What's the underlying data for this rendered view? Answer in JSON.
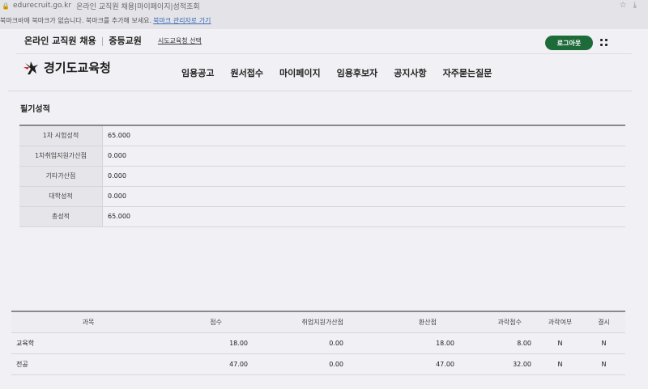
{
  "browser": {
    "url": "edurecruit.go.kr",
    "page_title": "온라인 교직원 채용|마이페이지|성적조회",
    "bookmark_message": "북마크바에 북마크가 없습니다. 북마크를 추가해 보세요.",
    "bookmark_link": "북마크 관리자로 가기"
  },
  "header": {
    "service_name": "온라인 교직원 채용",
    "category": "중등교원",
    "region_select": "시도교육청 선택",
    "logout_label": "로그아웃",
    "brand_name": "경기도교육청"
  },
  "nav": {
    "items": [
      "임용공고",
      "원서접수",
      "마이페이지",
      "임용후보자",
      "공지사항",
      "자주묻는질문"
    ]
  },
  "written_score": {
    "title": "필기성적",
    "rows": [
      {
        "label": "1차 시험성적",
        "value": "65.000"
      },
      {
        "label": "1차취업지원가산점",
        "value": "0.000"
      },
      {
        "label": "기타가산점",
        "value": "0.000"
      },
      {
        "label": "대학성적",
        "value": "0.000"
      },
      {
        "label": "총성적",
        "value": "65.000"
      }
    ]
  },
  "subject_table": {
    "headers": [
      "과목",
      "점수",
      "취업지원가산점",
      "환산점",
      "과락점수",
      "과락여부",
      "결시"
    ],
    "rows": [
      [
        "교육학",
        "18.00",
        "0.00",
        "18.00",
        "8.00",
        "N",
        "N"
      ],
      [
        "전공",
        "47.00",
        "0.00",
        "47.00",
        "32.00",
        "N",
        "N"
      ]
    ]
  },
  "colors": {
    "logout_bg": "#1e6b3a",
    "logo_red": "#d92a2a",
    "logo_dark": "#1f1f1f"
  }
}
